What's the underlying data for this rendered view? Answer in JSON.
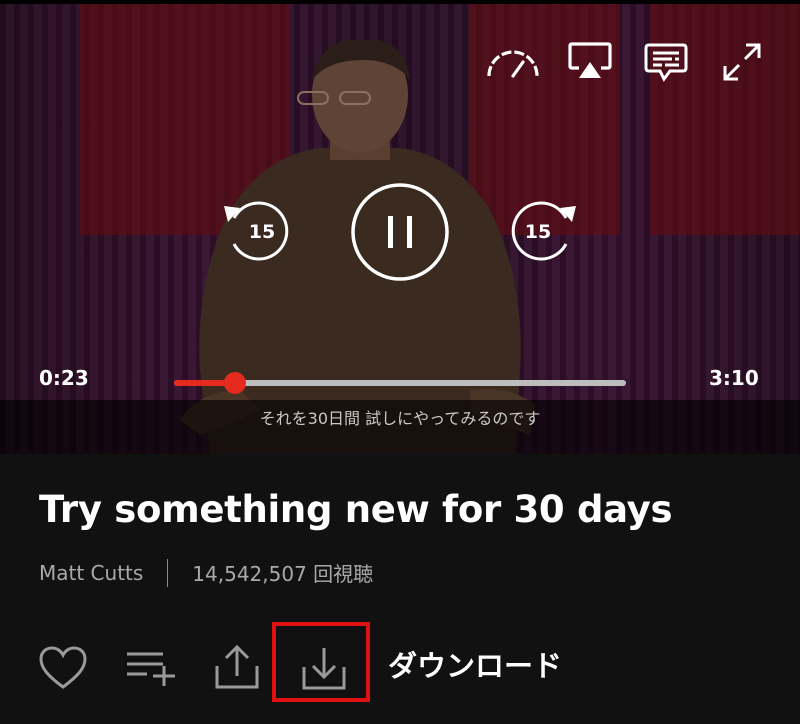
{
  "player": {
    "current_time": "0:23",
    "duration": "3:10",
    "progress": 0.135,
    "subtitle_text": "それを30日間 試しにやってみるのです",
    "skip_back_seconds": "15",
    "skip_forward_seconds": "15",
    "accent_color": "#e62b1e",
    "top_controls": [
      "speed-gauge-icon",
      "airplay-icon",
      "captions-icon",
      "fullscreen-expand-icon"
    ]
  },
  "talk": {
    "title": "Try something new for 30 days",
    "speaker": "Matt Cutts",
    "views": "14,542,507 回視聴"
  },
  "actions": {
    "items": [
      "heart-icon",
      "add-to-playlist-icon",
      "share-icon",
      "download-icon"
    ],
    "download_label": "ダウンロード",
    "highlight_color": "#e01111"
  }
}
